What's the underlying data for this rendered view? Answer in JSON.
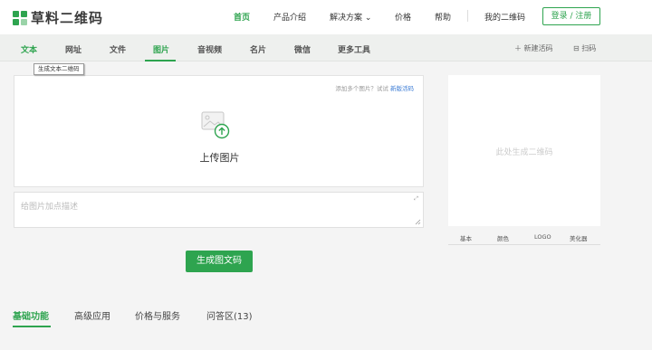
{
  "header": {
    "logo_text": "草料二维码",
    "nav": [
      "首页",
      "产品介绍",
      "解决方案 ⌄",
      "价格",
      "帮助",
      "我的二维码"
    ],
    "login_label": "登录 / 注册"
  },
  "tabs": {
    "items": [
      "文本",
      "网址",
      "文件",
      "图片",
      "音视频",
      "名片",
      "微信",
      "更多工具"
    ],
    "active": "图片",
    "new_code": "＋ 新建活码",
    "scan": "⊟ 扫码"
  },
  "tooltip": "生成文本二维码",
  "upload": {
    "hint": "添加多个图片？试试",
    "hint_link": "新版活码",
    "label": "上传图片"
  },
  "description": {
    "placeholder": "给图片加点描述",
    "corner": "⤢"
  },
  "generate_label": "生成图文码",
  "preview": {
    "placeholder": "此处生成二维码",
    "tabs": [
      "基本",
      "颜色",
      "LOGO",
      "美化器"
    ]
  },
  "bottom_tabs": {
    "items": [
      "基础功能",
      "高级应用",
      "价格与服务",
      "问答区(13)"
    ],
    "active": "基础功能"
  },
  "colors": {
    "accent": "#2ea44f",
    "link": "#3a7bd5"
  }
}
